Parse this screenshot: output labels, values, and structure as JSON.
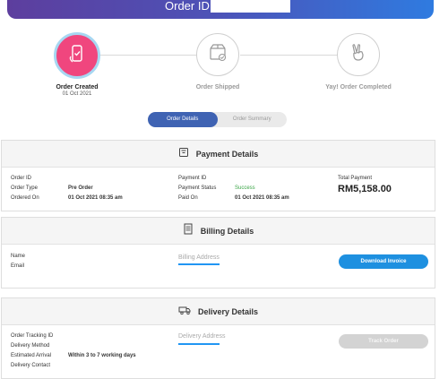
{
  "header": {
    "title": "Order ID:"
  },
  "progress": {
    "steps": [
      {
        "label": "Order Created",
        "date": "01 Oct 2021",
        "icon": "phone-check-icon",
        "active": true
      },
      {
        "label": "Order Shipped",
        "date": "",
        "icon": "box-check-icon",
        "active": false
      },
      {
        "label": "Yay! Order Completed",
        "date": "",
        "icon": "victory-hand-icon",
        "active": false
      }
    ],
    "active_color": "#f0467e"
  },
  "tabs": {
    "details": "Order Details",
    "summary": "Order Summary"
  },
  "payment": {
    "title": "Payment Details",
    "order_id_label": "Order ID",
    "order_type_label": "Order Type",
    "order_type_value": "Pre Order",
    "ordered_on_label": "Ordered On",
    "ordered_on_value": "01 Oct 2021 08:35 am",
    "payment_id_label": "Payment ID",
    "payment_status_label": "Payment Status",
    "payment_status_value": "Success",
    "paid_on_label": "Paid On",
    "paid_on_value": "01 Oct 2021 08:35 am",
    "total_label": "Total Payment",
    "total_value": "RM5,158.00"
  },
  "billing": {
    "title": "Billing Details",
    "name_label": "Name",
    "email_label": "Email",
    "address_title": "Billing Address",
    "download_button": "Download Invoice"
  },
  "delivery": {
    "title": "Delivery Details",
    "tracking_label": "Order Tracking ID",
    "method_label": "Delivery Method",
    "arrival_label": "Estimated Arrival",
    "arrival_value": "Within 3 to 7 working days",
    "contact_label": "Delivery Contact",
    "address_title": "Delivery Address",
    "track_button": "Track Order"
  }
}
